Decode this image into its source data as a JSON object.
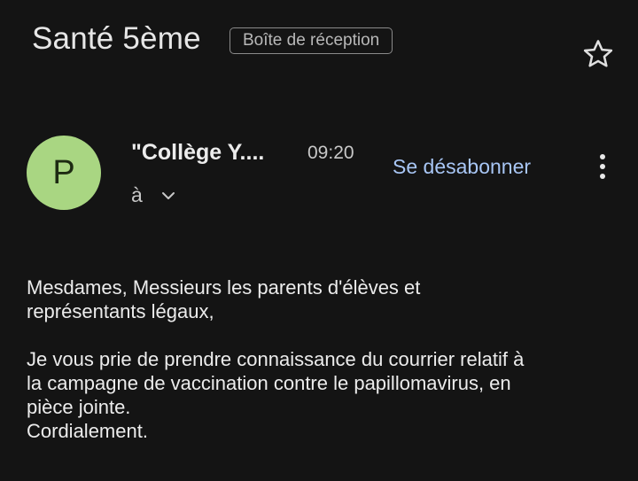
{
  "header": {
    "subject": "Santé 5ème",
    "label": "Boîte de réception",
    "star_icon": "star-outline-icon"
  },
  "message": {
    "avatar_letter": "P",
    "avatar_color": "#a9d682",
    "sender": "\"Collège Y....",
    "time": "09:20",
    "recipient": "à",
    "expand_icon": "chevron-down-icon",
    "unsubscribe_label": "Se désabonner",
    "more_icon": "more-vert-icon",
    "link_color": "#a8c6f5"
  },
  "body": {
    "greeting_line1": "Mesdames, Messieurs les parents d'élèves et",
    "greeting_line2": "représentants légaux,",
    "text_line1": "Je vous prie de prendre connaissance du courrier relatif à",
    "text_line2": "la campagne de vaccination contre le papillomavirus, en",
    "text_line3": "pièce jointe.",
    "closing": "Cordialement."
  }
}
